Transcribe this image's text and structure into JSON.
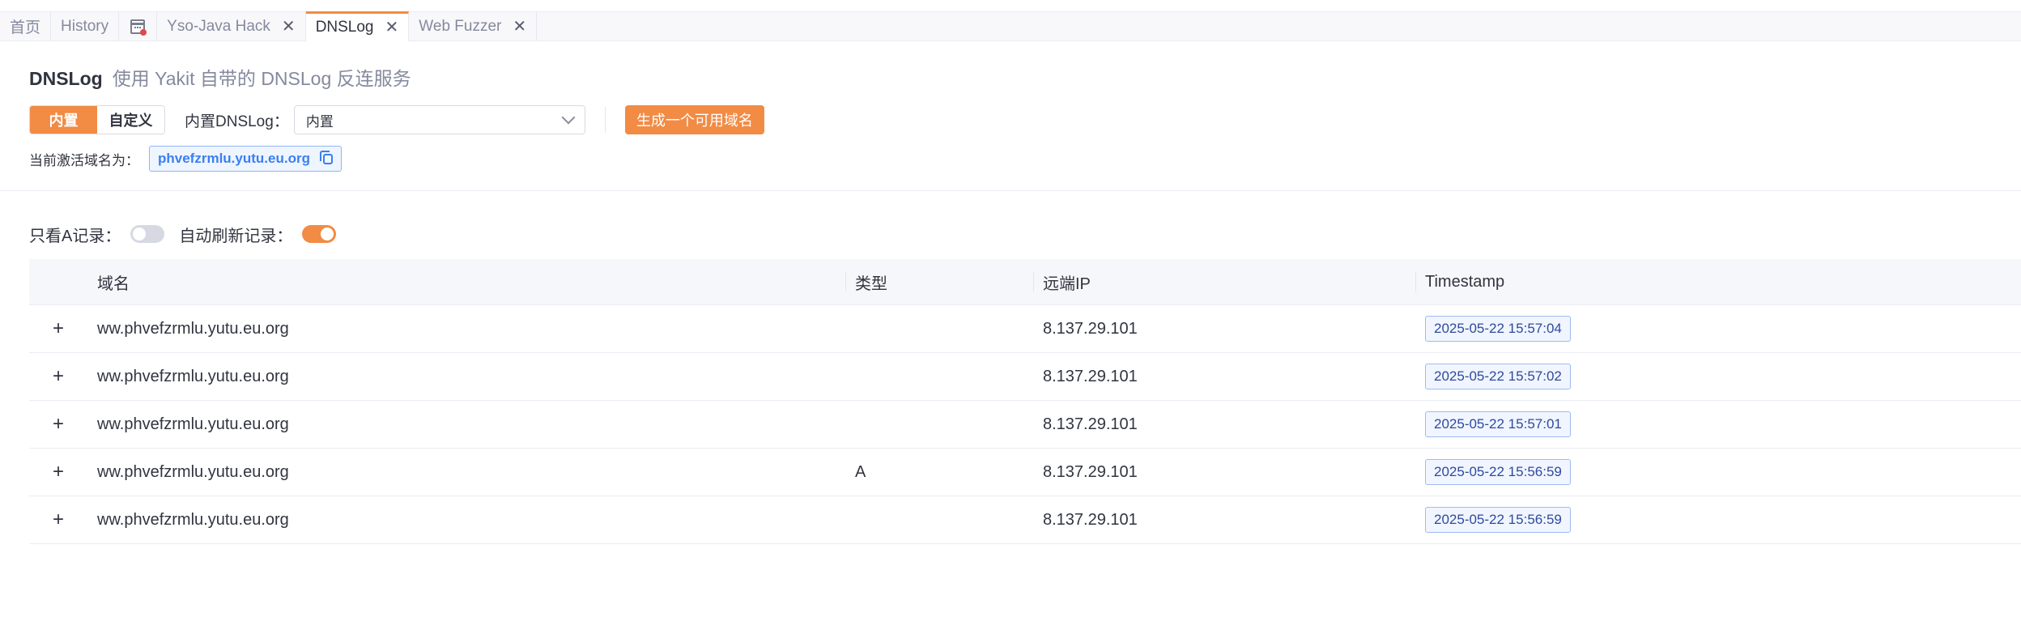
{
  "tabs": [
    {
      "label": "首页",
      "closable": false,
      "active": false
    },
    {
      "label": "History",
      "closable": false,
      "active": false
    },
    {
      "label": "",
      "icon": "calendar-icon",
      "closable": false,
      "active": false
    },
    {
      "label": "Yso-Java Hack",
      "closable": true,
      "active": false
    },
    {
      "label": "DNSLog",
      "closable": true,
      "active": true
    },
    {
      "label": "Web Fuzzer",
      "closable": true,
      "active": false
    }
  ],
  "close_glyph": "✕",
  "header": {
    "title": "DNSLog",
    "subtitle": "使用 Yakit 自带的 DNSLog 反连服务"
  },
  "controls": {
    "mode_builtin": "内置",
    "mode_custom": "自定义",
    "dnslog_label": "内置DNSLog：",
    "dnslog_selected": "内置",
    "generate_button": "生成一个可用域名",
    "active_domain_label": "当前激活域名为：",
    "active_domain": "phvefzrmlu.yutu.eu.org"
  },
  "filters": {
    "only_a_label": "只看A记录：",
    "only_a_on": false,
    "auto_refresh_label": "自动刷新记录：",
    "auto_refresh_on": true
  },
  "table": {
    "headers": [
      "域名",
      "类型",
      "远端IP",
      "Timestamp"
    ],
    "expand_glyph": "+",
    "rows": [
      {
        "domain": "ww.phvefzrmlu.yutu.eu.org",
        "type": "",
        "ip": "8.137.29.101",
        "timestamp": "2025-05-22 15:57:04"
      },
      {
        "domain": "ww.phvefzrmlu.yutu.eu.org",
        "type": "",
        "ip": "8.137.29.101",
        "timestamp": "2025-05-22 15:57:02"
      },
      {
        "domain": "ww.phvefzrmlu.yutu.eu.org",
        "type": "",
        "ip": "8.137.29.101",
        "timestamp": "2025-05-22 15:57:01"
      },
      {
        "domain": "ww.phvefzrmlu.yutu.eu.org",
        "type": "A",
        "ip": "8.137.29.101",
        "timestamp": "2025-05-22 15:56:59"
      },
      {
        "domain": "ww.phvefzrmlu.yutu.eu.org",
        "type": "",
        "ip": "8.137.29.101",
        "timestamp": "2025-05-22 15:56:59"
      }
    ]
  },
  "colors": {
    "accent": "#f28b44",
    "link_blue": "#3a7ff0"
  }
}
